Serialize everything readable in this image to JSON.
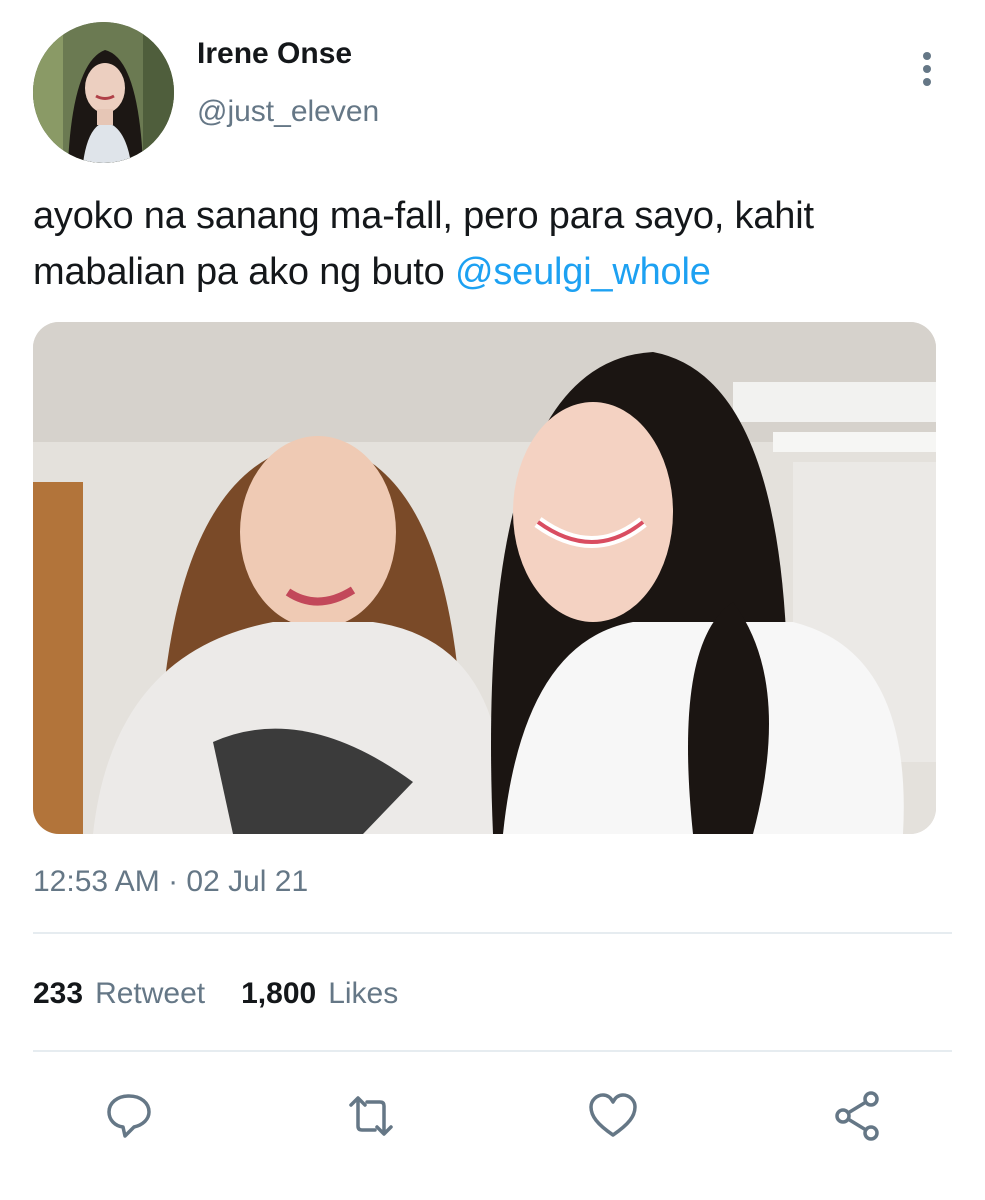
{
  "user": {
    "display_name": "Irene Onse",
    "handle": "@just_eleven",
    "avatar_icon": "user-avatar-photo"
  },
  "tweet": {
    "text": "ayoko na sanang ma-fall, pero para sayo, kahit mabalian pa ako ng buto ",
    "mention": "@seulgi_whole",
    "media_icon": "photo-of-two-people-smiling",
    "timestamp": "12:53 AM · 02 Jul 21"
  },
  "stats": {
    "retweets_count": "233",
    "retweets_label": "Retweet",
    "likes_count": "1,800",
    "likes_label": "Likes"
  },
  "actions": {
    "reply_icon": "reply-icon",
    "retweet_icon": "retweet-icon",
    "like_icon": "heart-icon",
    "share_icon": "share-icon"
  },
  "colors": {
    "accent": "#1da1f2",
    "text_primary": "#14171a",
    "text_secondary": "#657786",
    "divider": "#e6ecf0"
  }
}
